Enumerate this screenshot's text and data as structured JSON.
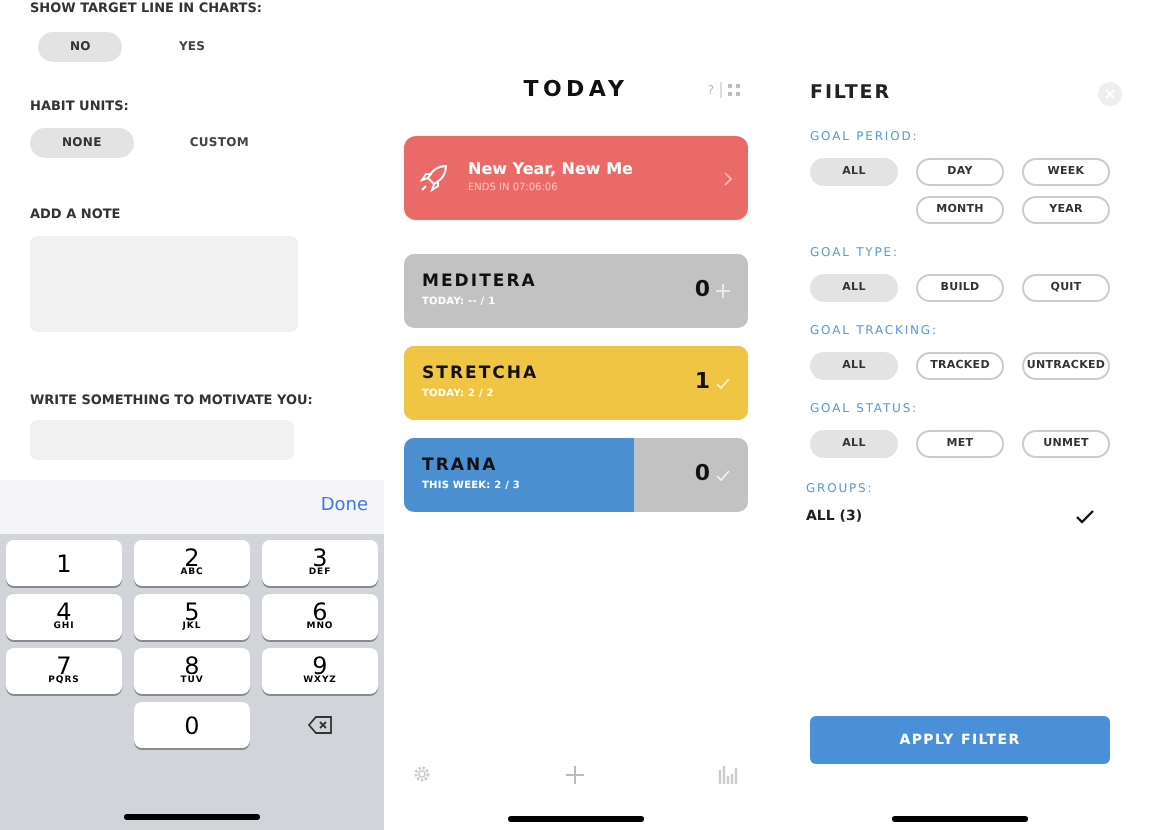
{
  "settings": {
    "show_target_line": {
      "label": "SHOW TARGET LINE IN CHARTS:",
      "options": [
        {
          "label": "NO",
          "selected": true
        },
        {
          "label": "YES",
          "selected": false
        }
      ]
    },
    "habit_units": {
      "label": "HABIT UNITS:",
      "options": [
        {
          "label": "NONE",
          "selected": true
        },
        {
          "label": "CUSTOM",
          "selected": false
        }
      ]
    },
    "note": {
      "label": "ADD A NOTE"
    },
    "motivation": {
      "label": "WRITE SOMETHING TO MOTIVATE YOU:"
    }
  },
  "keyboard": {
    "done": "Done",
    "keys": [
      {
        "digit": "1"
      },
      {
        "digit": "2",
        "letters": "ABC"
      },
      {
        "digit": "3",
        "letters": "DEF"
      },
      {
        "digit": "4",
        "letters": "GHI"
      },
      {
        "digit": "5",
        "letters": "JKL"
      },
      {
        "digit": "6",
        "letters": "MNO"
      },
      {
        "digit": "7",
        "letters": "PQRS"
      },
      {
        "digit": "8",
        "letters": "TUV"
      },
      {
        "digit": "9",
        "letters": "WXYZ"
      },
      {
        "digit": "0"
      }
    ]
  },
  "today": {
    "title": "TODAY",
    "help": "?",
    "challenge": {
      "title": "New Year, New Me",
      "subtitle": "ENDS IN 07:06:06"
    },
    "habits": [
      {
        "name": "MEDITERA",
        "subtitle": "TODAY: -- / 1",
        "count": "0",
        "kind": "add",
        "color": "#cfcfcf",
        "level": 0
      },
      {
        "name": "STRETCHA",
        "subtitle": "TODAY: 2 / 2",
        "count": "1",
        "kind": "check",
        "color": "#f0c544",
        "level": 1
      },
      {
        "name": "TRANA",
        "subtitle": "THIS WEEK: 2 / 3",
        "count": "0",
        "kind": "check",
        "color": "#4a90d0",
        "level": 0.67
      }
    ]
  },
  "filter": {
    "title": "FILTER",
    "sections": [
      {
        "label": "GOAL PERIOD:",
        "options": [
          {
            "label": "ALL",
            "selected": true
          },
          {
            "label": "DAY",
            "selected": false
          },
          {
            "label": "WEEK",
            "selected": false
          },
          {
            "label": "MONTH",
            "selected": false
          },
          {
            "label": "YEAR",
            "selected": false
          }
        ]
      },
      {
        "label": "GOAL TYPE:",
        "options": [
          {
            "label": "ALL",
            "selected": true
          },
          {
            "label": "BUILD",
            "selected": false
          },
          {
            "label": "QUIT",
            "selected": false
          }
        ]
      },
      {
        "label": "GOAL TRACKING:",
        "options": [
          {
            "label": "ALL",
            "selected": true
          },
          {
            "label": "TRACKED",
            "selected": false
          },
          {
            "label": "UNTRACKED",
            "selected": false
          }
        ]
      },
      {
        "label": "GOAL STATUS:",
        "options": [
          {
            "label": "ALL",
            "selected": true
          },
          {
            "label": "MET",
            "selected": false
          },
          {
            "label": "UNMET",
            "selected": false
          }
        ]
      }
    ],
    "groups": {
      "label": "GROUPS:",
      "items": [
        {
          "label": "ALL (3)",
          "checked": true
        }
      ]
    },
    "apply": "APPLY FILTER"
  }
}
